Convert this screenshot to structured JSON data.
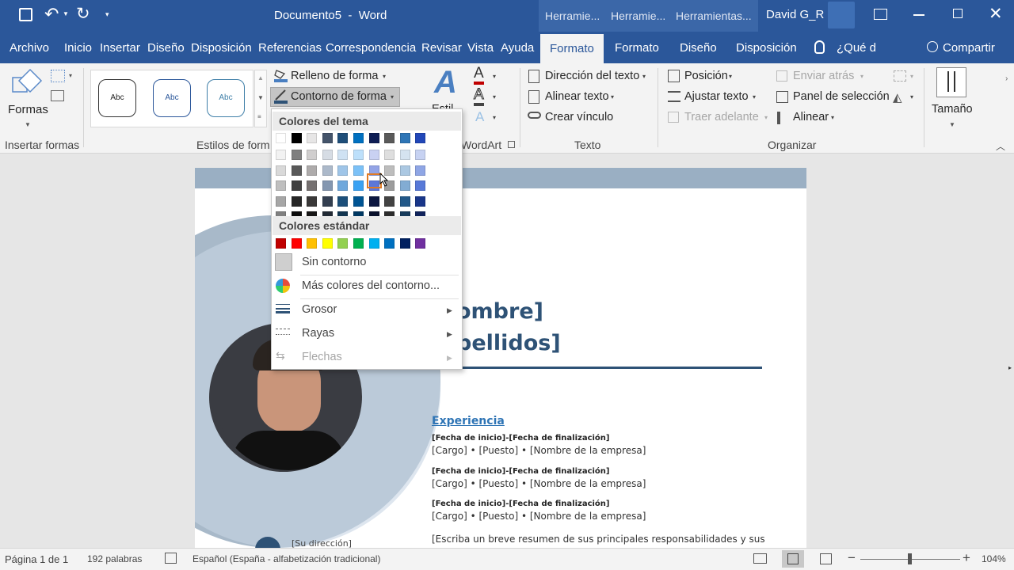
{
  "titlebar": {
    "doc_title": "Documento5  -  Word",
    "ctx_tabs": [
      "Herramie...",
      "Herramie...",
      "Herramientas..."
    ],
    "user": "David G_R"
  },
  "tabs": [
    "Archivo",
    "Inicio",
    "Insertar",
    "Diseño",
    "Disposición",
    "Referencias",
    "Correspondencia",
    "Revisar",
    "Vista",
    "Ayuda",
    "Formato",
    "Formato",
    "Diseño",
    "Disposición"
  ],
  "tell_me": "¿Qué d",
  "share": "Compartir",
  "ribbon": {
    "shapes_label": "Formas",
    "insert_shapes_group": "Insertar formas",
    "style_box_text": "Abc",
    "shape_styles_group": "Estilos de form",
    "fill_label": "Relleno de forma",
    "outline_label": "Contorno de forma",
    "wordart_styles_short": "Estil",
    "wordart_group": "WordArt",
    "text_direction": "Dirección del texto",
    "align_text": "Alinear texto",
    "create_link": "Crear vínculo",
    "text_group": "Texto",
    "position": "Posición",
    "wrap_text": "Ajustar texto",
    "bring_forward": "Traer adelante",
    "send_backward": "Enviar atrás",
    "selection_pane": "Panel de selección",
    "align": "Alinear",
    "arrange_group": "Organizar",
    "size": "Tamaño"
  },
  "menu": {
    "theme_colors_header": "Colores del tema",
    "standard_colors_header": "Colores estándar",
    "no_outline": "Sin contorno",
    "more_colors": "Más colores del contorno...",
    "weight": "Grosor",
    "dashes": "Rayas",
    "arrows": "Flechas",
    "theme_top_row": [
      "#ffffff",
      "#000000",
      "#e7e6e6",
      "#44546a",
      "#1f4e79",
      "#0070c0",
      "#0f1e55",
      "#5a5a5a",
      "#2e75b6",
      "#2147b8"
    ],
    "theme_columns": [
      [
        "#f2f2f2",
        "#d9d9d9",
        "#bfbfbf",
        "#a6a6a6",
        "#808080"
      ],
      [
        "#7f7f7f",
        "#595959",
        "#404040",
        "#262626",
        "#0d0d0d"
      ],
      [
        "#d0cece",
        "#aeabab",
        "#757070",
        "#3a3838",
        "#171616"
      ],
      [
        "#d6dce4",
        "#acb9ca",
        "#8497b0",
        "#333f50",
        "#222a35"
      ],
      [
        "#cfe2f3",
        "#9fc5e8",
        "#6fa8dc",
        "#1c4f7a",
        "#123550"
      ],
      [
        "#bde0fb",
        "#7cc1f7",
        "#3aa2f3",
        "#005493",
        "#003862"
      ],
      [
        "#c9d1f2",
        "#93a4e6",
        "#5d77d9",
        "#0c1740",
        "#08102b"
      ],
      [
        "#dedede",
        "#bdbdbd",
        "#9c9c9c",
        "#434343",
        "#2d2d2d"
      ],
      [
        "#d5e3f0",
        "#abc8e2",
        "#82acd3",
        "#225888",
        "#173b5b"
      ],
      [
        "#c7d2f2",
        "#8fa6e5",
        "#5879d8",
        "#193689",
        "#11245c"
      ]
    ],
    "standard_colors": [
      "#c00000",
      "#ff0000",
      "#ffc000",
      "#ffff00",
      "#92d050",
      "#00b050",
      "#00b0f0",
      "#0070c0",
      "#002060",
      "#7030a0"
    ]
  },
  "document": {
    "name_line1": "ombre]",
    "name_line2": "pellidos]",
    "experience_heading": "Experiencia",
    "dates": "[Fecha de inicio]-[Fecha de finalización]",
    "position_line": "[Cargo] • [Puesto] • [Nombre de la empresa]",
    "address": "[Su dirección]",
    "summary": "[Escriba un breve resumen de sus principales responsabilidades y sus"
  },
  "status": {
    "page": "Página 1 de 1",
    "words": "192 palabras",
    "language": "Español (España - alfabetización tradicional)",
    "zoom": "104%"
  },
  "colors": {
    "accent": "#2b579a",
    "doc_band": "#9aafc3",
    "doc_title": "#2e5276"
  }
}
